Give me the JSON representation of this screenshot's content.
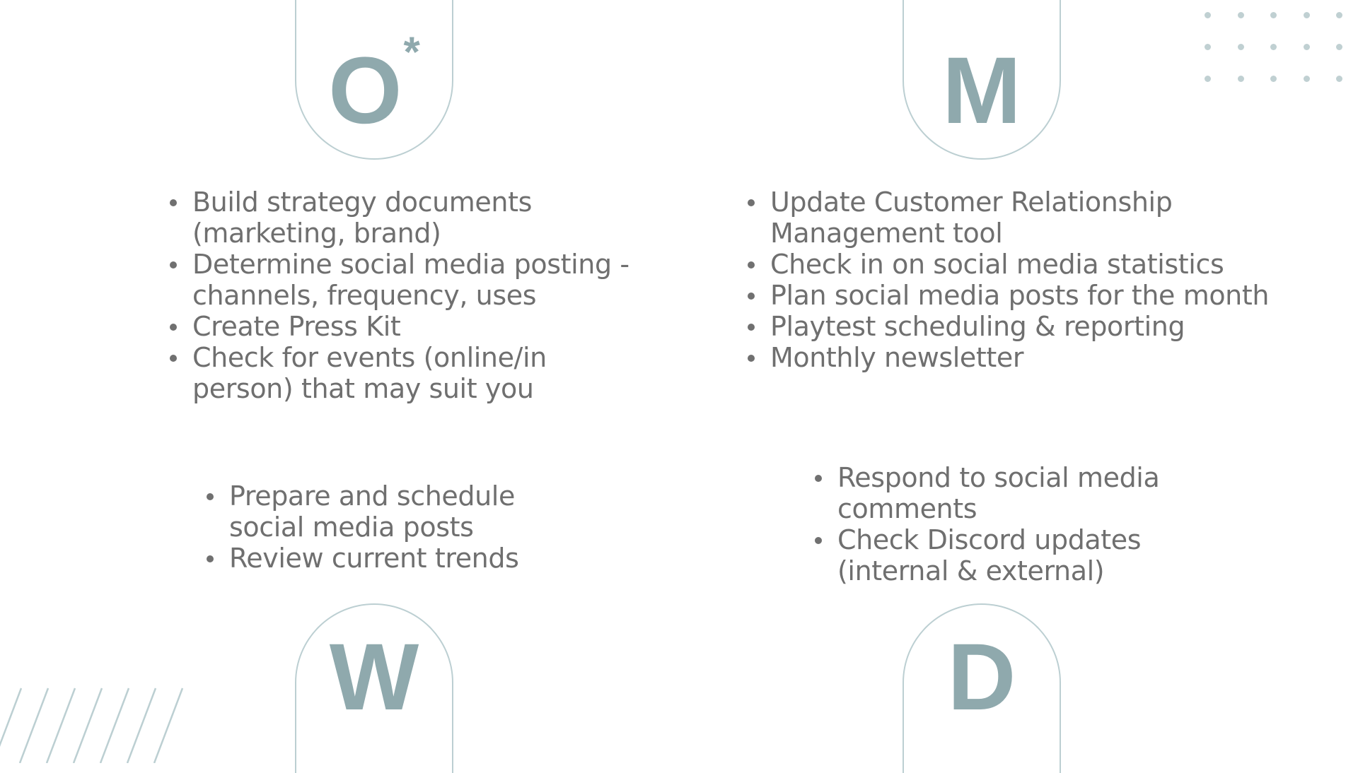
{
  "slide": {
    "quadrants": {
      "once": {
        "letter": "O",
        "marker": "*",
        "tasks": [
          "Build strategy documents (marketing, brand)",
          "Determine social media posting - channels, frequency, uses",
          "Create Press Kit",
          "Check for events (online/in person) that may suit you"
        ]
      },
      "monthly": {
        "letter": "M",
        "tasks": [
          "Update Customer Relationship Management tool",
          "Check in on social media statistics",
          "Plan social media posts for the month",
          "Playtest scheduling & reporting",
          "Monthly newsletter"
        ]
      },
      "weekly": {
        "letter": "W",
        "tasks": [
          "Prepare and schedule social media posts",
          "Review current trends"
        ]
      },
      "daily": {
        "letter": "D",
        "tasks": [
          "Respond to social media comments",
          "Check Discord updates (internal & external)"
        ]
      }
    },
    "colors": {
      "accent": "#8FA9AD",
      "outline": "#BCCFD2",
      "text": "#6F6F6F"
    }
  }
}
